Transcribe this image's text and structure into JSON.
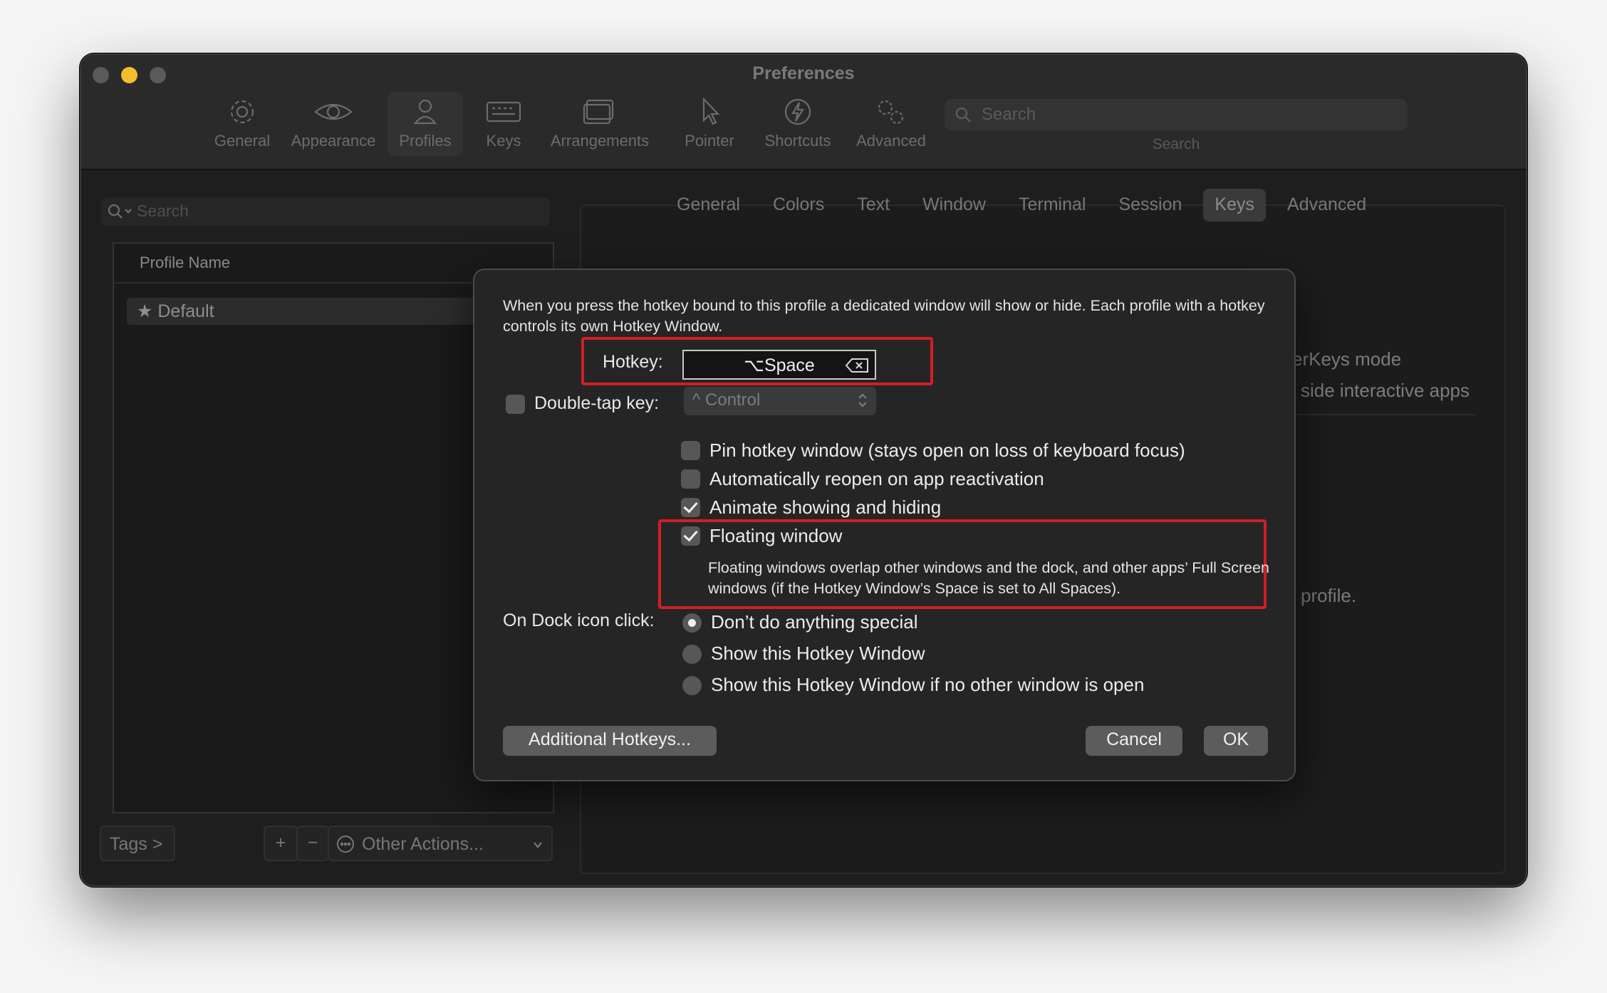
{
  "window": {
    "title": "Preferences"
  },
  "toolbar": {
    "items": [
      {
        "label": "General",
        "icon": "gear-icon"
      },
      {
        "label": "Appearance",
        "icon": "eye-icon"
      },
      {
        "label": "Profiles",
        "icon": "person-icon",
        "active": true
      },
      {
        "label": "Keys",
        "icon": "keyboard-icon"
      },
      {
        "label": "Arrangements",
        "icon": "windows-icon"
      },
      {
        "label": "Pointer",
        "icon": "pointer-icon"
      },
      {
        "label": "Shortcuts",
        "icon": "lightning-icon"
      },
      {
        "label": "Advanced",
        "icon": "gears-icon"
      }
    ],
    "search_placeholder": "Search",
    "search_label": "Search"
  },
  "profiles": {
    "search_placeholder": "Search",
    "column_header": "Profile Name",
    "rows": [
      {
        "name": "Default",
        "icon": "star-icon"
      }
    ],
    "tags_button": "Tags >",
    "add_button": "+",
    "remove_button": "−",
    "other_actions": "Other Actions..."
  },
  "profile_tabs": {
    "items": [
      "General",
      "Colors",
      "Text",
      "Window",
      "Terminal",
      "Session",
      "Keys",
      "Advanced"
    ],
    "active": "Keys"
  },
  "background_fragments": {
    "line1": "erKeys mode",
    "line2": "side interactive apps",
    "line3": "profile."
  },
  "dialog": {
    "description": "When you press the hotkey bound to this profile a dedicated window will show or hide. Each profile with a hotkey controls its own Hotkey Window.",
    "hotkey_label": "Hotkey:",
    "hotkey_value": "⌥Space",
    "double_tap_label": "Double-tap key:",
    "double_tap_checked": false,
    "double_tap_value": "^ Control",
    "options": [
      {
        "label": "Pin hotkey window (stays open on loss of keyboard focus)",
        "checked": false
      },
      {
        "label": "Automatically reopen on app reactivation",
        "checked": false
      },
      {
        "label": "Animate showing and hiding",
        "checked": true
      },
      {
        "label": "Floating window",
        "checked": true
      }
    ],
    "floating_help": "Floating windows overlap other windows and the dock, and other apps’ Full Screen windows (if the Hotkey Window’s Space is set to All Spaces).",
    "dock_label": "On Dock icon click:",
    "dock_options": [
      {
        "label": "Don’t do anything special",
        "selected": true
      },
      {
        "label": "Show this Hotkey Window",
        "selected": false
      },
      {
        "label": "Show this Hotkey Window if no other window is open",
        "selected": false
      }
    ],
    "additional_hotkeys": "Additional Hotkeys...",
    "cancel": "Cancel",
    "ok": "OK"
  },
  "colors": {
    "highlight": "#d31e26",
    "accent_yellow": "#f5bd2e"
  }
}
